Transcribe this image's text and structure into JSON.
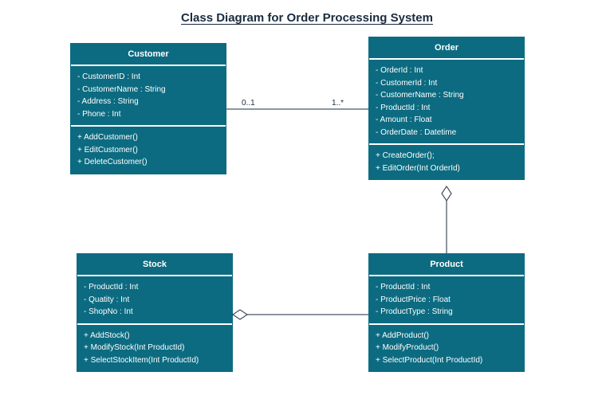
{
  "title": "Class Diagram for Order Processing System",
  "classes": {
    "customer": {
      "name": "Customer",
      "attrs": [
        "- CustomerID : Int",
        "- CustomerName : String",
        "- Address : String",
        "- Phone : Int"
      ],
      "ops": [
        "+ AddCustomer()",
        "+ EditCustomer()",
        "+ DeleteCustomer()"
      ]
    },
    "order": {
      "name": "Order",
      "attrs": [
        "- OrderId : Int",
        "- CustomerId : Int",
        "- CustomerName : String",
        "- ProductId : Int",
        "- Amount : Float",
        "- OrderDate : Datetime"
      ],
      "ops": [
        "+ CreateOrder();",
        "+ EditOrder(Int OrderId)"
      ]
    },
    "stock": {
      "name": "Stock",
      "attrs": [
        "- ProductId : Int",
        "- Quatity : Int",
        "- ShopNo : Int"
      ],
      "ops": [
        "+ AddStock()",
        "+ ModifyStock(Int ProductId)",
        "+ SelectStockItem(Int ProductId)"
      ]
    },
    "product": {
      "name": "Product",
      "attrs": [
        "- ProductId : Int",
        "- ProductPrice : Float",
        "- ProductType : String"
      ],
      "ops": [
        "+ AddProduct()",
        "+ ModifyProduct()",
        "+ SelectProduct(Int ProductId)"
      ]
    }
  },
  "assoc": {
    "left": "0..1",
    "right": "1..*"
  }
}
